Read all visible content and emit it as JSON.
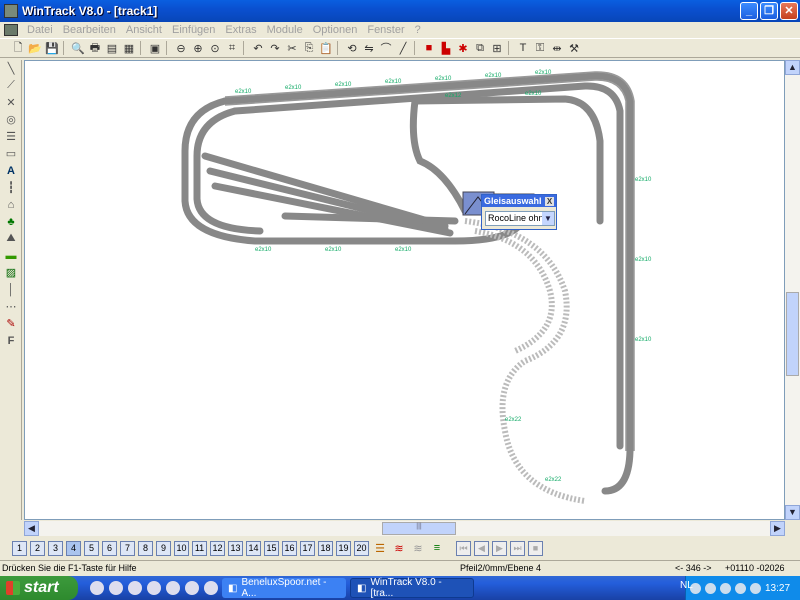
{
  "window": {
    "title": "WinTrack  V8.0 - [track1]",
    "controls": {
      "minimize": "_",
      "restore": "❐",
      "close": "✕"
    }
  },
  "menu": [
    "Datei",
    "Bearbeiten",
    "Ansicht",
    "Einfügen",
    "Extras",
    "Module",
    "Optionen",
    "Fenster",
    "?"
  ],
  "toolbar_icons": [
    "new-icon",
    "open-icon",
    "save-icon",
    "print-preview-icon",
    "print-icon",
    "print-setup-icon",
    "list-icon",
    "image-icon",
    "zoom-out-icon",
    "zoom-in-icon",
    "zoom-window-icon",
    "zoom-fit-icon",
    "undo-icon",
    "redo-icon",
    "cut-icon",
    "copy-icon",
    "paste-icon",
    "rotate-icon",
    "flip-icon",
    "curve-icon",
    "line-icon",
    "signal-red-icon",
    "signal-block-icon",
    "connector-icon",
    "layer-icon",
    "grid-icon",
    "text-icon",
    "lock-icon",
    "measure-icon",
    "tools-icon"
  ],
  "left_tools": [
    "track-tool",
    "switch-tool",
    "crossing-tool",
    "turntable-tool",
    "rail-tool",
    "ground-tool",
    "text-tool",
    "signal-tool",
    "building-tool",
    "tree-tool",
    "terrain-tool",
    "landscape-tool",
    "view-tool",
    "line-tool",
    "dots-tool",
    "paint-tool",
    "font-tool"
  ],
  "gleisauswahl": {
    "title": "Gleisauswahl",
    "close": "X",
    "selected": "RocoLine ohne"
  },
  "pages": [
    "1",
    "2",
    "3",
    "4",
    "5",
    "6",
    "7",
    "8",
    "9",
    "10",
    "11",
    "12",
    "13",
    "14",
    "15",
    "16",
    "17",
    "18",
    "19",
    "20"
  ],
  "status": {
    "help": "Drücken Sie die  F1-Taste für Hilfe",
    "mode": "Pfeil2/0mm/Ebene 4",
    "nav": "<- 346 ->",
    "coord_x": "+01110",
    "coord_y": "-02026"
  },
  "taskbar": {
    "start": "start",
    "tasks": [
      "BeneluxSpoor.net - A...",
      "WinTrack  V8.0 - [tra..."
    ],
    "lang": "NL",
    "time": "13:27"
  },
  "track_labels": [
    "e2x10",
    "e2x12",
    "e2x22"
  ],
  "scroll": {
    "left": "◀",
    "right": "▶",
    "up": "▲",
    "down": "▼",
    "grip": "|||"
  }
}
